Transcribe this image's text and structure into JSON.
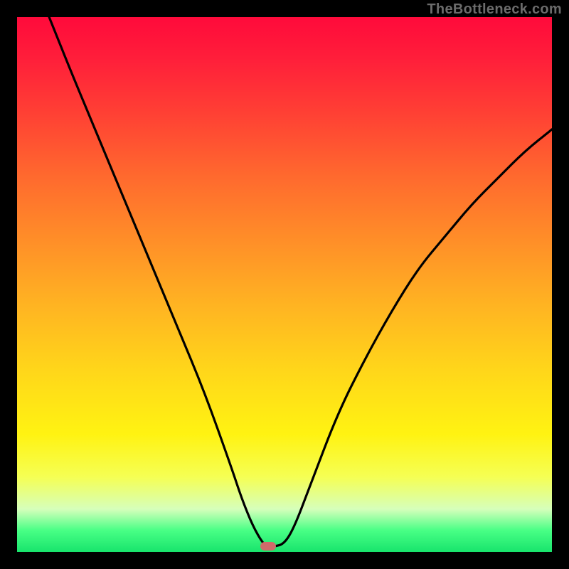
{
  "watermark": "TheBottleneck.com",
  "chart_data": {
    "type": "line",
    "title": "",
    "xlabel": "",
    "ylabel": "",
    "xlim": [
      0,
      100
    ],
    "ylim": [
      0,
      100
    ],
    "grid": false,
    "legend": false,
    "background_gradient": [
      "#ff0a3b",
      "#ffd61a",
      "#18e46c"
    ],
    "series": [
      {
        "name": "bottleneck-curve",
        "color": "#000000",
        "x": [
          6,
          10,
          15,
          20,
          25,
          30,
          35,
          40,
          42,
          44,
          46,
          47,
          48,
          50,
          52,
          55,
          60,
          65,
          70,
          75,
          80,
          85,
          90,
          95,
          100
        ],
        "values": [
          100,
          90,
          78,
          66,
          54,
          42,
          30,
          16,
          10,
          5,
          1.5,
          1.0,
          1.0,
          1.5,
          5,
          13,
          26,
          36,
          45,
          53,
          59,
          65,
          70,
          75,
          79
        ]
      }
    ],
    "marker": {
      "x": 47,
      "y": 1.0,
      "color": "#d06a6a",
      "shape": "rounded-rect"
    }
  }
}
